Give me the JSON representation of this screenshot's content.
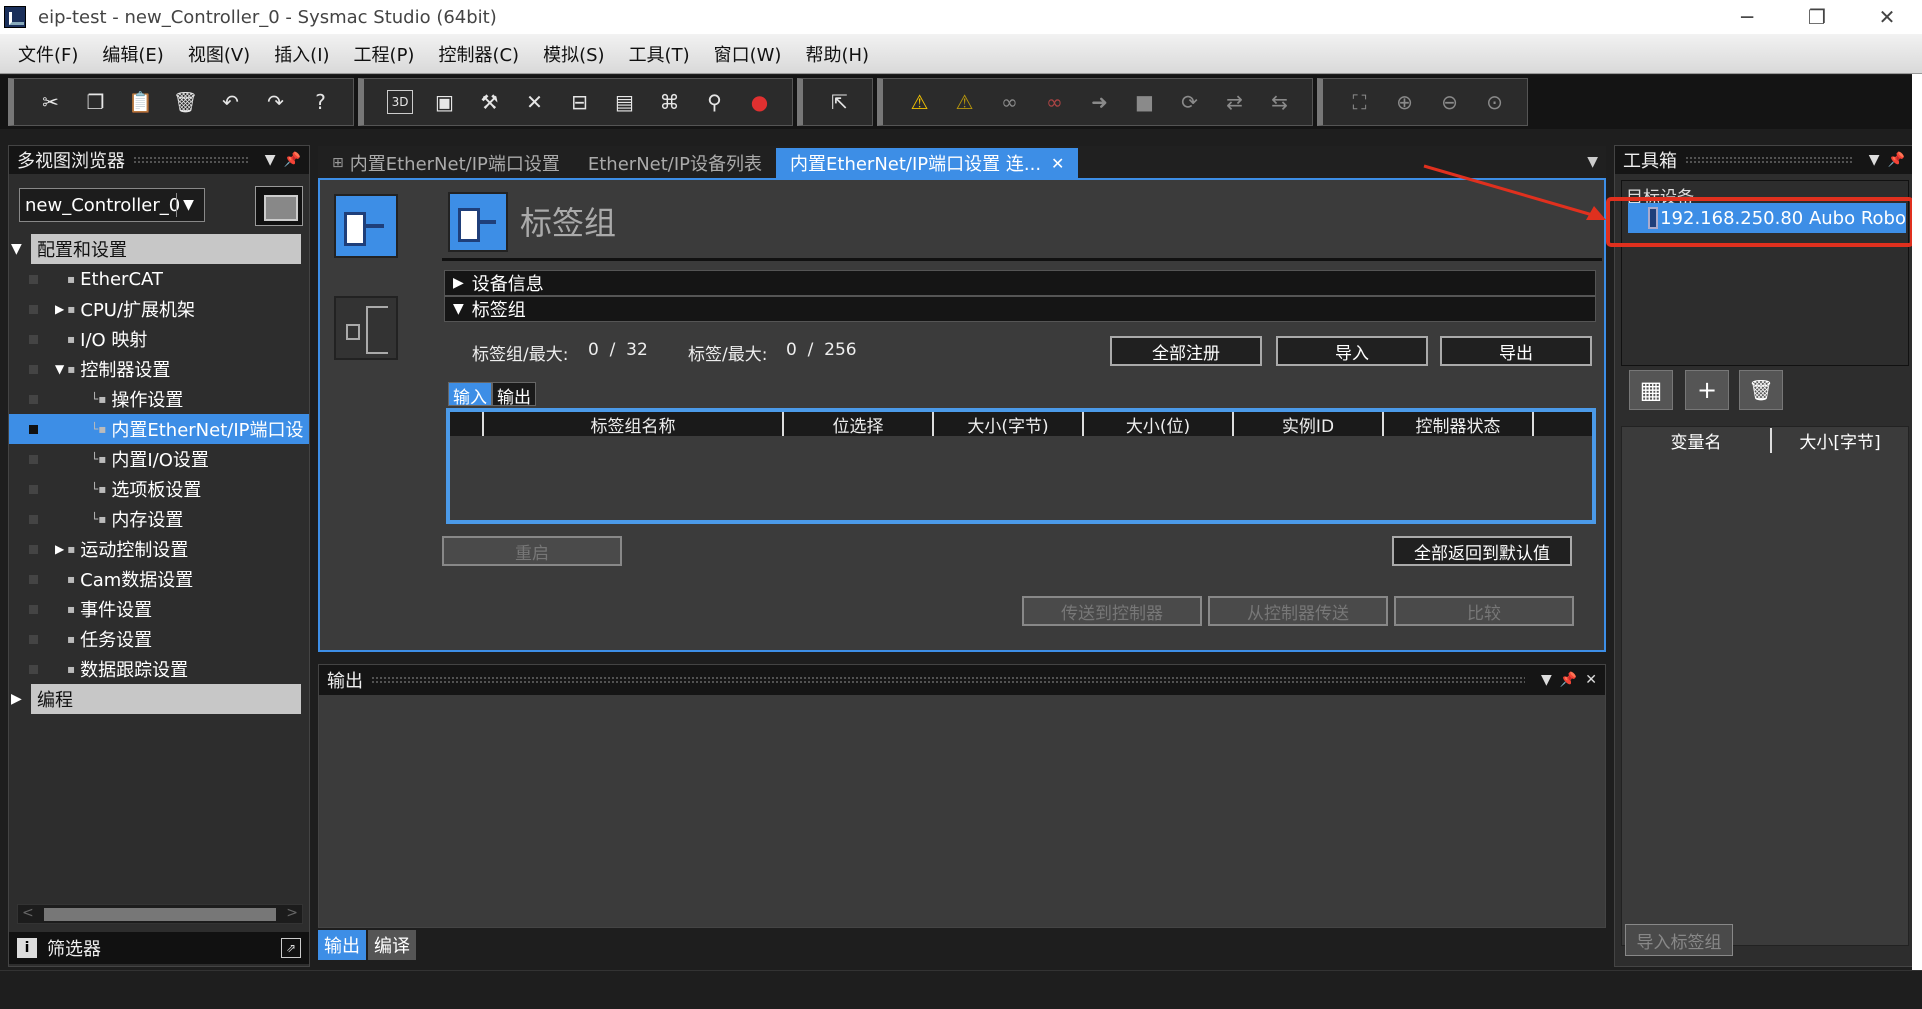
{
  "window": {
    "title": "eip-test - new_Controller_0 - Sysmac Studio (64bit)",
    "minimize": "─",
    "maximize": "❐",
    "close": "✕"
  },
  "menu": [
    "文件(F)",
    "编辑(E)",
    "视图(V)",
    "插入(I)",
    "工程(P)",
    "控制器(C)",
    "模拟(S)",
    "工具(T)",
    "窗口(W)",
    "帮助(H)"
  ],
  "toolbar": {
    "group1": [
      "cut-icon",
      "copy-icon",
      "paste-icon",
      "delete-icon",
      "undo-icon",
      "redo-icon",
      "help-icon"
    ],
    "group2": [
      "3d-icon",
      "window-icon",
      "build-icon",
      "cross-ref-icon",
      "compare-icon",
      "table-icon",
      "network-icon",
      "search-icon",
      "error-icon"
    ],
    "group3": [
      "online-icon"
    ],
    "group4": [
      "warning-icon",
      "warning-off-icon",
      "watch-icon",
      "watch-off-icon",
      "transfer-icon",
      "stop-icon",
      "refresh-icon",
      "sync-icon",
      "sync2-icon"
    ],
    "group5": [
      "fit-icon",
      "zoom-in-icon",
      "zoom-out-icon",
      "zoom-reset-icon"
    ],
    "label_3d": "3D"
  },
  "left_panel": {
    "title": "多视图浏览器",
    "controller": "new_Controller_0",
    "tree": [
      {
        "label": "配置和设置",
        "type": "section"
      },
      {
        "label": "EtherCAT",
        "indent": 1
      },
      {
        "label": "CPU/扩展机架",
        "indent": 1,
        "expand": "▶"
      },
      {
        "label": "I/O 映射",
        "indent": 1
      },
      {
        "label": "控制器设置",
        "indent": 1,
        "expand": "▼"
      },
      {
        "label": "操作设置",
        "indent": 2
      },
      {
        "label": "内置EtherNet/IP端口设",
        "indent": 2,
        "selected": true
      },
      {
        "label": "内置I/O设置",
        "indent": 2
      },
      {
        "label": "选项板设置",
        "indent": 2
      },
      {
        "label": "内存设置",
        "indent": 2
      },
      {
        "label": "运动控制设置",
        "indent": 1,
        "expand": "▶"
      },
      {
        "label": "Cam数据设置",
        "indent": 1
      },
      {
        "label": "事件设置",
        "indent": 1
      },
      {
        "label": "任务设置",
        "indent": 1
      },
      {
        "label": "数据跟踪设置",
        "indent": 1
      },
      {
        "label": "编程",
        "type": "section"
      }
    ],
    "filter_label": "筛选器"
  },
  "editor": {
    "tabs": [
      {
        "label": "内置EtherNet/IP端口设置",
        "active": false
      },
      {
        "label": "EtherNet/IP设备列表",
        "active": false
      },
      {
        "label": "内置EtherNet/IP端口设置 连...",
        "active": true
      }
    ],
    "header_title": "标签组",
    "section_device": "设备信息",
    "section_tags": "标签组",
    "stats": {
      "group_label": "标签组/最大:",
      "group_value": "0  /  32",
      "tag_label": "标签/最大:",
      "tag_value": "0  /  256"
    },
    "buttons": {
      "register_all": "全部注册",
      "import": "导入",
      "export": "导出",
      "restart": "重启",
      "reset_default": "全部返回到默认值",
      "transfer_to": "传送到控制器",
      "transfer_from": "从控制器传送",
      "compare": "比较"
    },
    "io_tabs": [
      "输入",
      "输出"
    ],
    "columns": [
      "",
      "标签组名称",
      "位选择",
      "大小(字节)",
      "大小(位)",
      "实例ID",
      "控制器状态",
      ""
    ]
  },
  "output_panel": {
    "title": "输出",
    "tabs": [
      "输出",
      "编译"
    ]
  },
  "right_panel": {
    "title": "工具箱",
    "target_label": "目标设备",
    "device": "192.168.250.80  Aubo Robo",
    "columns": [
      "变量名",
      "大小[字节]"
    ],
    "import_button": "导入标签组"
  },
  "colors": {
    "accent": "#3d8ee6",
    "highlight": "#e0301e",
    "background": "#2d2d2d"
  }
}
